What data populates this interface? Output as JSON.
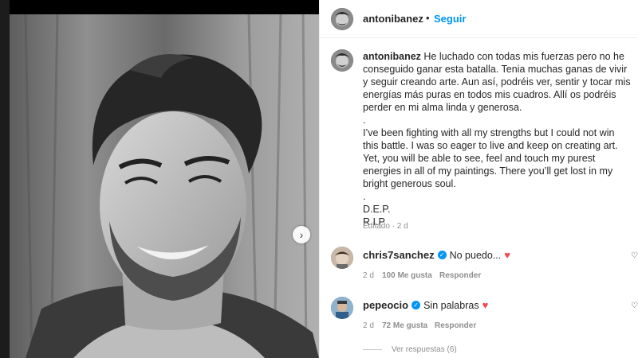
{
  "post": {
    "author": "antonibanez",
    "separator": "•",
    "follow_label": "Seguir",
    "carousel_next_icon": "chevron-right-icon"
  },
  "caption": {
    "username": "antonibanez",
    "spanish": "He luchado con todas mis fuerzas pero no he conseguido ganar esta batalla. Tenia muchas ganas de vivir y seguir creando arte. Aun así, podréis ver, sentir y tocar mis energías más puras en todos mis cuadros. Allí os podréis perder en mi alma linda y generosa.",
    "dot1": ".",
    "english": "I’ve been fighting with all my strengths but I could not win this battle. I was so eager to live and keep on creating art. Yet, you will be able to see, feel and touch my purest energies in all of my paintings. There you’ll get lost in my bright generous soul.",
    "dot2": ".",
    "line1": "D.E.P.",
    "line2": "R.I.P",
    "edited": "Editado · 2 d"
  },
  "comments": [
    {
      "username": "chris7sanchez",
      "text": "No puedo...",
      "time": "2 d",
      "likes": "100 Me gusta",
      "reply": "Responder"
    },
    {
      "username": "pepeocio",
      "text": "Sin palabras",
      "time": "2 d",
      "likes": "72 Me gusta",
      "reply": "Responder",
      "view_replies": "Ver respuestas (6)"
    }
  ],
  "colors": {
    "link_blue": "#0095f6",
    "heart_red": "#ed4956",
    "muted_text": "#8e8e8e"
  }
}
